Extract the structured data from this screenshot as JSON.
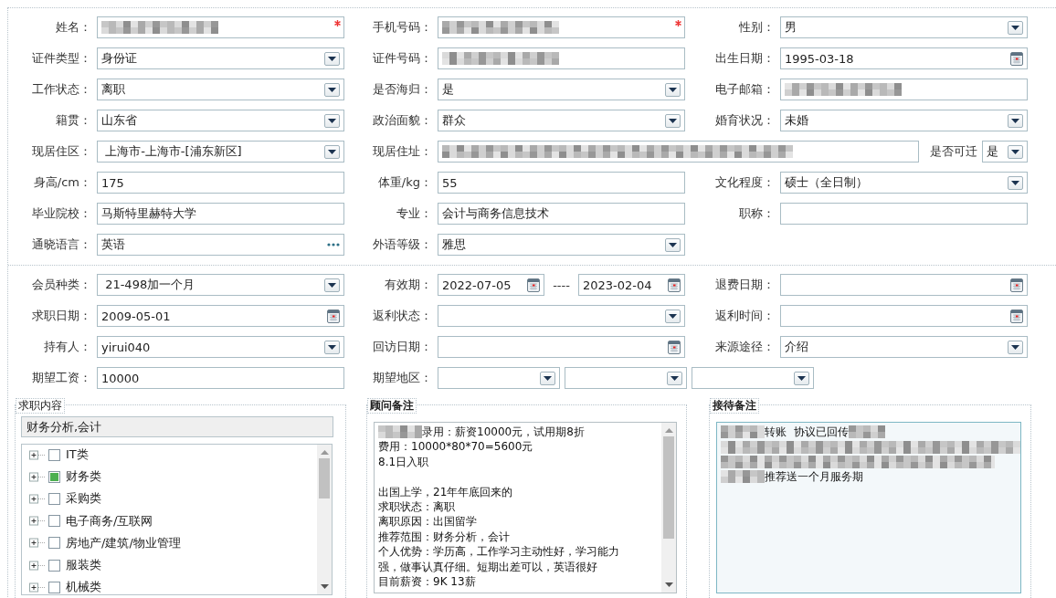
{
  "sections": [
    {
      "rows": [
        [
          {
            "label": "姓名：",
            "controls": [
              {
                "kind": "text",
                "redacted": true,
                "required": true
              }
            ]
          },
          {
            "label": "手机号码：",
            "controls": [
              {
                "kind": "text",
                "redacted": true,
                "required": true
              }
            ]
          },
          {
            "label": "性别：",
            "controls": [
              {
                "kind": "select",
                "value": "男"
              }
            ]
          }
        ],
        [
          {
            "label": "证件类型：",
            "controls": [
              {
                "kind": "select",
                "value": "身份证"
              }
            ]
          },
          {
            "label": "证件号码：",
            "controls": [
              {
                "kind": "text",
                "redacted": true
              }
            ]
          },
          {
            "label": "出生日期：",
            "controls": [
              {
                "kind": "date",
                "value": "1995-03-18"
              }
            ]
          }
        ],
        [
          {
            "label": "工作状态：",
            "controls": [
              {
                "kind": "select",
                "value": "离职"
              }
            ]
          },
          {
            "label": "是否海归：",
            "controls": [
              {
                "kind": "select",
                "value": "是"
              }
            ]
          },
          {
            "label": "电子邮箱：",
            "controls": [
              {
                "kind": "text",
                "redacted": true
              }
            ]
          }
        ],
        [
          {
            "label": "籍贯：",
            "controls": [
              {
                "kind": "select",
                "value": "山东省"
              }
            ]
          },
          {
            "label": "政治面貌：",
            "controls": [
              {
                "kind": "select",
                "value": "群众"
              }
            ]
          },
          {
            "label": "婚育状况：",
            "controls": [
              {
                "kind": "select",
                "value": "未婚"
              }
            ]
          }
        ],
        [
          {
            "label": "现居住区：",
            "controls": [
              {
                "kind": "select",
                "value": " 上海市-上海市-[浦东新区]"
              }
            ]
          },
          {
            "label": "现居住址：",
            "controls": [
              {
                "kind": "text",
                "redacted": true
              },
              {
                "kind": "label",
                "text": "是否可迁"
              },
              {
                "kind": "select",
                "value": "是"
              }
            ]
          }
        ],
        [
          {
            "label": "身高/cm：",
            "controls": [
              {
                "kind": "text",
                "value": "175"
              }
            ]
          },
          {
            "label": "体重/kg：",
            "controls": [
              {
                "kind": "text",
                "value": "55"
              }
            ]
          },
          {
            "label": "文化程度：",
            "controls": [
              {
                "kind": "select",
                "value": "硕士（全日制）"
              }
            ]
          }
        ],
        [
          {
            "label": "毕业院校：",
            "controls": [
              {
                "kind": "text",
                "value": "马斯特里赫特大学"
              }
            ]
          },
          {
            "label": "专业：",
            "controls": [
              {
                "kind": "text",
                "value": "会计与商务信息技术"
              }
            ]
          },
          {
            "label": "职称：",
            "controls": [
              {
                "kind": "text"
              }
            ]
          }
        ],
        [
          {
            "label": "通晓语言：",
            "controls": [
              {
                "kind": "lookup",
                "value": "英语"
              }
            ]
          },
          {
            "label": "外语等级：",
            "controls": [
              {
                "kind": "select",
                "value": "雅思"
              }
            ]
          }
        ]
      ]
    },
    {
      "rows": [
        [
          {
            "label": "会员种类：",
            "controls": [
              {
                "kind": "select",
                "value": " 21-498加一个月"
              }
            ]
          },
          {
            "label": "有效期：",
            "controls": [
              {
                "kind": "date",
                "value": "2022-07-05"
              },
              {
                "kind": "label",
                "text": "----"
              },
              {
                "kind": "date",
                "value": "2023-02-04"
              }
            ]
          },
          {
            "label": "退费日期：",
            "controls": [
              {
                "kind": "date"
              }
            ]
          }
        ],
        [
          {
            "label": "求职日期：",
            "controls": [
              {
                "kind": "date",
                "value": "2009-05-01"
              }
            ]
          },
          {
            "label": "返利状态：",
            "controls": [
              {
                "kind": "select"
              }
            ]
          },
          {
            "label": "返利时间：",
            "controls": [
              {
                "kind": "date"
              }
            ]
          }
        ],
        [
          {
            "label": "持有人：",
            "controls": [
              {
                "kind": "select",
                "value": "yirui040"
              }
            ]
          },
          {
            "label": "回访日期：",
            "controls": [
              {
                "kind": "date"
              }
            ]
          },
          {
            "label": "来源途径：",
            "controls": [
              {
                "kind": "select",
                "value": "介绍"
              }
            ]
          }
        ],
        [
          {
            "label": "期望工资：",
            "controls": [
              {
                "kind": "text",
                "value": "10000"
              }
            ]
          },
          {
            "label": "期望地区：",
            "controls": [
              {
                "kind": "select"
              },
              {
                "kind": "select"
              },
              {
                "kind": "select"
              }
            ]
          }
        ]
      ]
    }
  ],
  "job_content": {
    "legend": "求职内容",
    "summary": "财务分析,会计",
    "tree": [
      {
        "label": "IT类",
        "checked": false
      },
      {
        "label": "财务类",
        "checked": true
      },
      {
        "label": "采购类",
        "checked": false
      },
      {
        "label": "电子商务/互联网",
        "checked": false
      },
      {
        "label": "房地产/建筑/物业管理",
        "checked": false
      },
      {
        "label": "服装类",
        "checked": false
      },
      {
        "label": "机械类",
        "checked": false
      }
    ]
  },
  "notes": [
    {
      "legend": "顾问备注",
      "bold": true,
      "tinted": false,
      "scrollbar": true,
      "paragraphs": [
        [
          {
            "text": "录用：薪资10000元，试用期8折",
            "redacted_before": true
          },
          {
            "text": "费用：10000*80*70=5600元"
          },
          {
            "text": "8.1日入职"
          }
        ],
        [
          {
            "text": "出国上学，21年年底回来的"
          },
          {
            "text": "求职状态：离职"
          },
          {
            "text": "离职原因：出国留学"
          },
          {
            "text": "推荐范围：财务分析，会计"
          },
          {
            "text": "个人优势：学历高，工作学习主动性好，学习能力"
          },
          {
            "text": "强，做事认真仔细。短期出差可以，英语很好"
          },
          {
            "text": "目前薪资：9K 13薪"
          }
        ]
      ]
    },
    {
      "legend": "接待备注",
      "bold": true,
      "tinted": true,
      "scrollbar": false,
      "paragraphs": [
        [
          {
            "text": "转账  协议已回传",
            "redacted_before": true,
            "redacted_after": true
          },
          {
            "redacted_before": true
          },
          {
            "redacted_before": true
          },
          {
            "text": "推荐送一个月服务期",
            "redacted_before": true
          }
        ]
      ]
    }
  ]
}
